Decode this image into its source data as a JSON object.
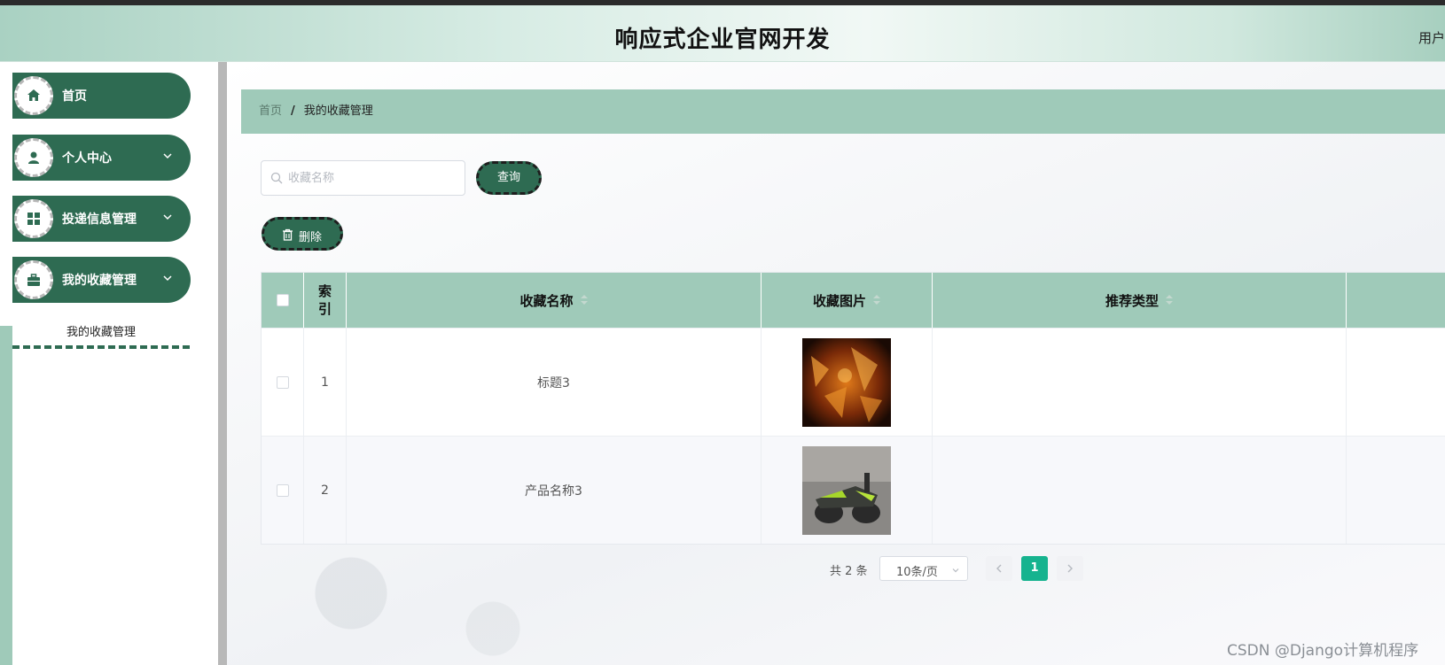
{
  "header": {
    "title": "响应式企业官网开发",
    "user": "用户"
  },
  "sidebar": {
    "items": [
      {
        "label": "首页"
      },
      {
        "label": "个人中心"
      },
      {
        "label": "投递信息管理"
      },
      {
        "label": "我的收藏管理"
      }
    ],
    "submenu": {
      "label": "我的收藏管理"
    }
  },
  "breadcrumb": {
    "home": "首页",
    "separator": "/",
    "current": "我的收藏管理"
  },
  "search": {
    "placeholder": "收藏名称",
    "query_label": "查询"
  },
  "toolbar": {
    "delete_label": "删除"
  },
  "table": {
    "columns": [
      "索引",
      "收藏名称",
      "收藏图片",
      "推荐类型"
    ],
    "rows": [
      {
        "index": "1",
        "name": "标题3",
        "image": "currency-symbols-image",
        "type": ""
      },
      {
        "index": "2",
        "name": "产品名称3",
        "image": "scooter-image",
        "type": ""
      }
    ]
  },
  "pagination": {
    "total": "共 2 条",
    "page_size": "10条/页",
    "current_page": "1"
  },
  "watermark": "CSDN @Django计算机程序",
  "colors": {
    "accent": "#2e6b52",
    "header_bg": "#9fcab9",
    "page_active": "#16b38f"
  }
}
